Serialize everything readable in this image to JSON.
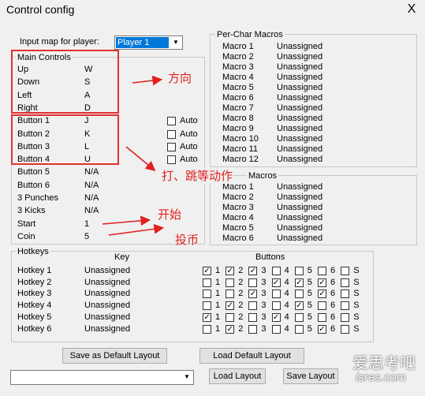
{
  "window": {
    "title": "Control config",
    "close": "X"
  },
  "player": {
    "label": "Input map for player:",
    "value": "Player 1"
  },
  "main_controls": {
    "title": "Main Controls",
    "rows": [
      {
        "name": "Up",
        "key": "W"
      },
      {
        "name": "Down",
        "key": "S"
      },
      {
        "name": "Left",
        "key": "A"
      },
      {
        "name": "Right",
        "key": "D"
      },
      {
        "name": "Button 1",
        "key": "J",
        "auto": "Auto"
      },
      {
        "name": "Button 2",
        "key": "K",
        "auto": "Auto"
      },
      {
        "name": "Button 3",
        "key": "L",
        "auto": "Auto"
      },
      {
        "name": "Button 4",
        "key": "U",
        "auto": "Auto"
      },
      {
        "name": "Button 5",
        "key": "N/A"
      },
      {
        "name": "Button 6",
        "key": "N/A"
      },
      {
        "name": "3 Punches",
        "key": "N/A"
      },
      {
        "name": "3 Kicks",
        "key": "N/A"
      },
      {
        "name": "Start",
        "key": "1"
      },
      {
        "name": "Coin",
        "key": "5"
      }
    ]
  },
  "per_char_macros": {
    "title": "Per-Char Macros",
    "rows": [
      {
        "name": "Macro 1",
        "value": "Unassigned"
      },
      {
        "name": "Macro 2",
        "value": "Unassigned"
      },
      {
        "name": "Macro 3",
        "value": "Unassigned"
      },
      {
        "name": "Macro 4",
        "value": "Unassigned"
      },
      {
        "name": "Macro 5",
        "value": "Unassigned"
      },
      {
        "name": "Macro 6",
        "value": "Unassigned"
      },
      {
        "name": "Macro 7",
        "value": "Unassigned"
      },
      {
        "name": "Macro 8",
        "value": "Unassigned"
      },
      {
        "name": "Macro 9",
        "value": "Unassigned"
      },
      {
        "name": "Macro 10",
        "value": "Unassigned"
      },
      {
        "name": "Macro 11",
        "value": "Unassigned"
      },
      {
        "name": "Macro 12",
        "value": "Unassigned"
      }
    ]
  },
  "macros": {
    "title_visible": "Macros",
    "rows": [
      {
        "name": "Macro 1",
        "value": "Unassigned"
      },
      {
        "name": "Macro 2",
        "value": "Unassigned"
      },
      {
        "name": "Macro 3",
        "value": "Unassigned"
      },
      {
        "name": "Macro 4",
        "value": "Unassigned"
      },
      {
        "name": "Macro 5",
        "value": "Unassigned"
      },
      {
        "name": "Macro 6",
        "value": "Unassigned"
      }
    ]
  },
  "hotkeys": {
    "title": "Hotkeys",
    "key_header": "Key",
    "buttons_header": "Buttons",
    "button_labels": [
      "1",
      "2",
      "3",
      "4",
      "5",
      "6",
      "S"
    ],
    "rows": [
      {
        "name": "Hotkey 1",
        "value": "Unassigned",
        "checks": [
          true,
          true,
          true,
          false,
          false,
          false,
          false
        ]
      },
      {
        "name": "Hotkey 2",
        "value": "Unassigned",
        "checks": [
          false,
          false,
          false,
          true,
          true,
          true,
          false
        ]
      },
      {
        "name": "Hotkey 3",
        "value": "Unassigned",
        "checks": [
          false,
          false,
          true,
          false,
          false,
          true,
          false
        ]
      },
      {
        "name": "Hotkey 4",
        "value": "Unassigned",
        "checks": [
          false,
          true,
          false,
          false,
          true,
          false,
          false
        ]
      },
      {
        "name": "Hotkey 5",
        "value": "Unassigned",
        "checks": [
          true,
          false,
          false,
          true,
          false,
          false,
          false
        ]
      },
      {
        "name": "Hotkey 6",
        "value": "Unassigned",
        "checks": [
          false,
          true,
          false,
          false,
          false,
          true,
          false
        ]
      }
    ]
  },
  "buttons": {
    "save_default": "Save as  Default Layout",
    "load_default": "Load Default Layout",
    "load_layout": "Load Layout",
    "save_layout": "Save Layout"
  },
  "layout_select": {
    "value": ""
  },
  "annotations": {
    "direction": "方向",
    "attack": "打、跳等动作",
    "start": "开始",
    "coin": "投币",
    "color": "#e02020"
  },
  "watermark": {
    "line1": "爱思考吧",
    "line2": "isres.com"
  }
}
